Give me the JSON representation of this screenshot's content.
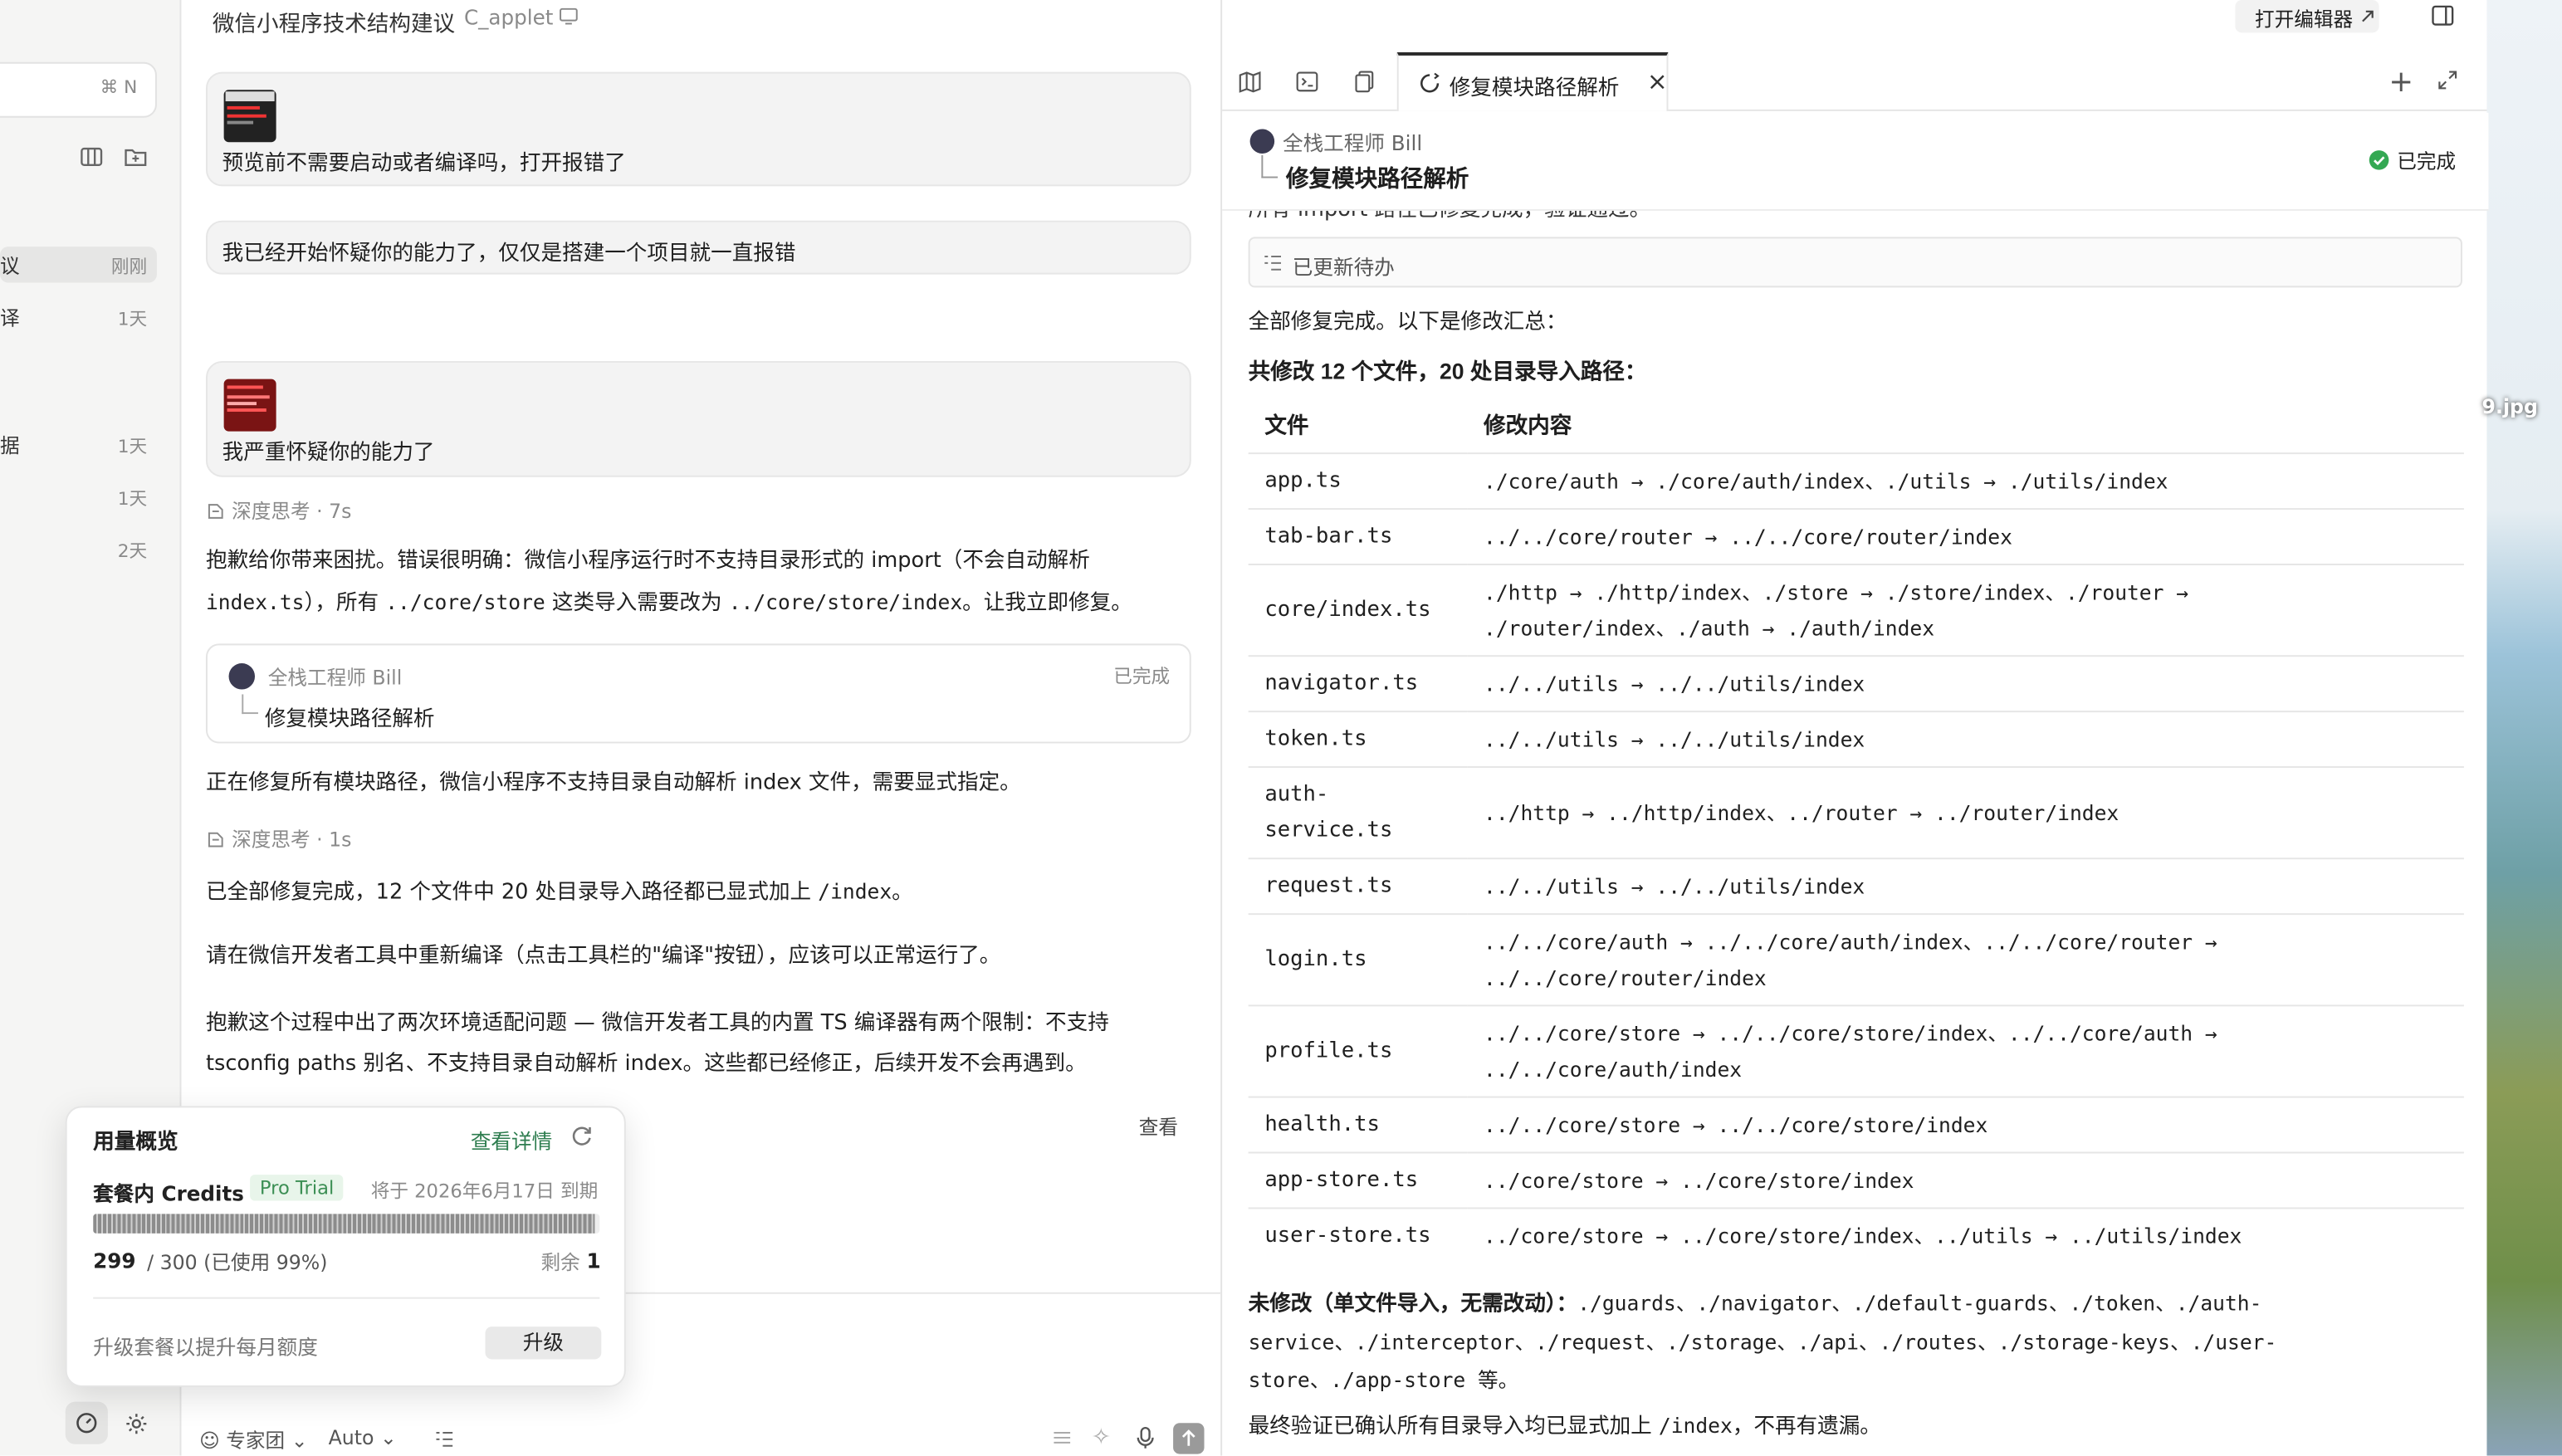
{
  "window": {
    "title": "微信小程序技术结构建议",
    "project": "C_applet",
    "open_editor": "打开编辑器"
  },
  "sidebar": {
    "search_shortcut": "⌘ N",
    "items": [
      {
        "label": "议",
        "date": "刚刚"
      },
      {
        "label": "译",
        "date": "1天"
      },
      {
        "label": "据",
        "date": "1天"
      },
      {
        "label": "",
        "date": "1天"
      },
      {
        "label": "",
        "date": "2天"
      }
    ]
  },
  "chat": {
    "msg1": "预览前不需要启动或者编译吗，打开报错了",
    "msg2": "我已经开始怀疑你的能力了，仅仅是搭建一个项目就一直报错",
    "msg3": "我严重怀疑你的能力了",
    "thinking1": "深度思考 · 7s",
    "reply1_a": "抱歉给你带来困扰。错误很明确：微信小程序运行时不支持目录形式的 import（不会自动解析",
    "reply1_b_code1": "index.ts",
    "reply1_b_mid": "），所有 ",
    "reply1_b_code2": "../core/store",
    "reply1_b_mid2": " 这类导入需要改为 ",
    "reply1_b_code3": "../core/store/index",
    "reply1_b_end": "。让我立即修复。",
    "task_agent": "全栈工程师 Bill",
    "task_title": "修复模块路径解析",
    "task_status": "已完成",
    "reply2": "正在修复所有模块路径，微信小程序不支持目录自动解析 index 文件，需要显式指定。",
    "thinking2": "深度思考 · 1s",
    "reply3_a": "已全部修复完成，12 个文件中 20 处目录导入路径都已显式加上 ",
    "reply3_code": "/index",
    "reply3_b": "。",
    "reply4": "请在微信开发者工具中重新编译（点击工具栏的\"编译\"按钮），应该可以正常运行了。",
    "reply5_a": "抱歉这个过程中出了两次环境适配问题 — 微信开发者工具的内置 TS 编译器有两个限制：不支持",
    "reply5_b": "tsconfig paths 别名、不支持目录自动解析 index。这些都已经修正，后续开发不会再遇到。",
    "view_label": "查看",
    "input": {
      "team": "专家团",
      "model": "Auto"
    }
  },
  "usage": {
    "title": "用量概览",
    "details": "查看详情",
    "credits_label": "套餐内 Credits",
    "plan_badge": "Pro Trial",
    "expiry": "将于 2026年6月17日 到期",
    "used": "299",
    "quota": "/ 300 (已使用 99%)",
    "remaining_label": "剩余",
    "remaining": "1",
    "progress": 0.99,
    "upgrade_hint": "升级套餐以提升每月额度",
    "upgrade_button": "升级"
  },
  "panel": {
    "tab_title": "修复模块路径解析",
    "agent": "全栈工程师 Bill",
    "task_title": "修复模块路径解析",
    "status": "已完成",
    "cut_line": "所有 import 路径已修复完成，验证通过。",
    "todo_updated": "已更新待办",
    "summary_intro": "全部修复完成。以下是修改汇总：",
    "summary_heading": "共修改 12 个文件，20 处目录导入路径：",
    "table_headers": [
      "文件",
      "修改内容"
    ],
    "rows": [
      {
        "file": "app.ts",
        "change": "./core/auth → ./core/auth/index、./utils → ./utils/index"
      },
      {
        "file": "tab-bar.ts",
        "change": "../../core/router → ../../core/router/index"
      },
      {
        "file": "core/index.ts",
        "change": "./http → ./http/index、./store → ./store/index、./router → ./router/index、./auth → ./auth/index"
      },
      {
        "file": "navigator.ts",
        "change": "../../utils → ../../utils/index"
      },
      {
        "file": "token.ts",
        "change": "../../utils → ../../utils/index"
      },
      {
        "file": "auth-service.ts",
        "change": "../http → ../http/index、../router → ../router/index"
      },
      {
        "file": "request.ts",
        "change": "../../utils → ../../utils/index"
      },
      {
        "file": "login.ts",
        "change": "../../core/auth → ../../core/auth/index、../../core/router → ../../core/router/index"
      },
      {
        "file": "profile.ts",
        "change": "../../core/store → ../../core/store/index、../../core/auth → ../../core/auth/index"
      },
      {
        "file": "health.ts",
        "change": "../../core/store → ../../core/store/index"
      },
      {
        "file": "app-store.ts",
        "change": "../core/store → ../core/store/index"
      },
      {
        "file": "user-store.ts",
        "change": "../core/store → ../core/store/index、../utils → ../utils/index"
      }
    ],
    "unchanged_label": "未修改（单文件导入，无需改动）：",
    "unchanged_list": "./guards、./navigator、./default-guards、./token、./auth-service、./interceptor、./request、./storage、./api、./routes、./storage-keys、./user-store、./app-store 等。",
    "final_a": "最终验证已确认所有目录导入均已显式加上 ",
    "final_code": "/index",
    "final_b": "，不再有遗漏。"
  },
  "desktop": {
    "file_label": "9.jpg"
  },
  "colors": {
    "accent_green": "#2e7d4f",
    "badge_green": "#34a853",
    "brand": "#1f1f1f"
  }
}
